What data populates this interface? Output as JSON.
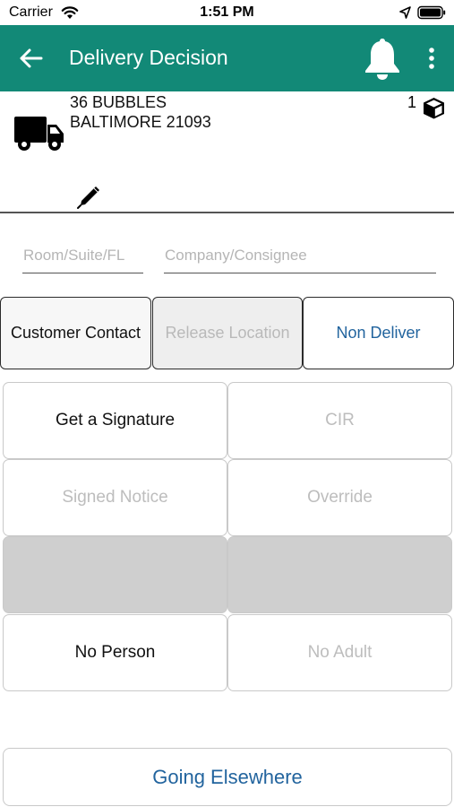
{
  "status_bar": {
    "carrier": "Carrier",
    "time": "1:51 PM",
    "icons": [
      "wifi-icon",
      "location-arrow-icon",
      "battery-icon"
    ]
  },
  "app_bar": {
    "title": "Delivery Decision",
    "color": "#128977",
    "icons": [
      "back-arrow-icon",
      "bell-icon",
      "more-vertical-icon"
    ]
  },
  "address": {
    "line1": "36 BUBBLES",
    "line2": "BALTIMORE 21093",
    "piece_count": "1",
    "icons": [
      "truck-icon",
      "package-icon",
      "pen-icon"
    ]
  },
  "fields": {
    "room_placeholder": "Room/Suite/FL",
    "room_value": "",
    "company_placeholder": "Company/Consignee",
    "company_value": ""
  },
  "segments": {
    "customer_contact": "Customer Contact",
    "release_location": "Release Location",
    "non_deliver": "Non Deliver",
    "selected": "Non Deliver"
  },
  "options": {
    "get_signature": "Get a Signature",
    "cir": "CIR",
    "signed_notice": "Signed Notice",
    "override": "Override",
    "no_person": "No Person",
    "no_adult": "No Adult"
  },
  "bottom": {
    "going_elsewhere": "Going Elsewhere"
  },
  "colors": {
    "accent": "#128977",
    "link_blue": "#22649e",
    "disabled_text": "#bdbdbd",
    "empty_cell": "#cfcfcf"
  }
}
